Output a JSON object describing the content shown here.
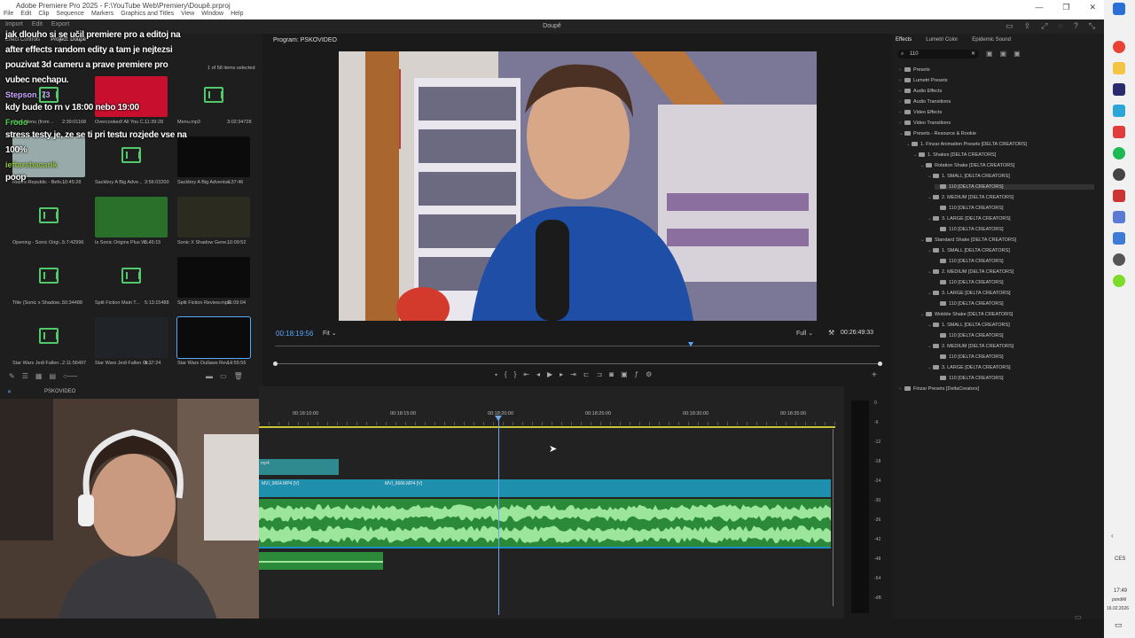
{
  "titlebar": {
    "app_title": "Adobe Premiere Pro 2025 - F:\\YouTube Web\\Premiery\\Doupě.prproj",
    "menu": [
      "File",
      "Edit",
      "Clip",
      "Sequence",
      "Markers",
      "Graphics and Titles",
      "View",
      "Window",
      "Help"
    ]
  },
  "appbar": {
    "document": "Doupě",
    "tabs": [
      "Import",
      "Edit",
      "Export"
    ]
  },
  "project": {
    "tabs": [
      "Effect Controls",
      "Project: Doupě"
    ],
    "count": "1 of 58 items selected",
    "items": [
      {
        "name": "Main Menu (from ..",
        "dur": "2:39:01168"
      },
      {
        "name": "Overcooked! All You C...",
        "dur": "11:39:28"
      },
      {
        "name": "Menu.mp3",
        "dur": "3:02:34728"
      },
      {
        "name": "Riders Republic - Befo...",
        "dur": "10:45:28"
      },
      {
        "name": "Sackboy A Big Adve...",
        "dur": "3:56:03200"
      },
      {
        "name": "Sackboy A Big Adventu...",
        "dur": "4:37:46"
      },
      {
        "name": "Opening - Sonic Origi...",
        "dur": "5:7:42996"
      },
      {
        "name": "Is Sonic Origins Plus W...",
        "dur": "5:45:15"
      },
      {
        "name": "Sonic X Shadow Gene...",
        "dur": "10:09:52"
      },
      {
        "name": "Title (Sonic x Shadow...",
        "dur": "50:34488"
      },
      {
        "name": "Split Fiction Main T...",
        "dur": "5:13:15488"
      },
      {
        "name": "Split Fiction Review.mp4",
        "dur": "11:09:04"
      },
      {
        "name": "Star Wars Jedi Fallen...",
        "dur": "2:11:56497"
      },
      {
        "name": "Star Wars Jedi Fallen Or...",
        "dur": "6:37:24"
      },
      {
        "name": "Star Wars Outlaws Rev...",
        "dur": "14:55:56"
      }
    ],
    "chat": [
      {
        "type": "line",
        "text": "jak dlouho si se učil premiere pro a editoj na"
      },
      {
        "type": "line",
        "text": "after effects random edity a tam je nejtezsi"
      },
      {
        "type": "line",
        "text": "pouzivat 3d cameru a prave premiere pro"
      },
      {
        "type": "line",
        "text": "vubec nechapu."
      },
      {
        "type": "user",
        "text": "Stepson_73",
        "color": "#c9a6ff"
      },
      {
        "type": "line",
        "text": "kdy bude to rn v 18:00 nebo 19:00"
      },
      {
        "type": "user",
        "text": "Frodo",
        "color": "#4dd24d"
      },
      {
        "type": "line",
        "text": "stress testy je, ze se ti pri testu rozjede vse na"
      },
      {
        "type": "line",
        "text": "100%"
      },
      {
        "type": "user",
        "text": "ieftarsbacarik",
        "color": "#8fbf3f"
      },
      {
        "type": "line",
        "text": "poop"
      }
    ]
  },
  "program": {
    "label": "Program: PSKOVIDEO",
    "timecode_left": "00:18:19:56",
    "fit": "Fit",
    "quality": "Full",
    "timecode_right": "00:26:49:33"
  },
  "effects": {
    "tabs": [
      "Effects",
      "Lumetri Color",
      "Epidemic Sound"
    ],
    "search": "110",
    "tree": [
      {
        "depth": 0,
        "label": "Presets",
        "open": false
      },
      {
        "depth": 0,
        "label": "Lumetri Presets",
        "open": false
      },
      {
        "depth": 0,
        "label": "Audio Effects",
        "open": false
      },
      {
        "depth": 0,
        "label": "Audio Transitions",
        "open": false
      },
      {
        "depth": 0,
        "label": "Video Effects",
        "open": false
      },
      {
        "depth": 0,
        "label": "Video Transitions",
        "open": false
      },
      {
        "depth": 0,
        "label": "Presets - Resource & Rookie",
        "open": true
      },
      {
        "depth": 1,
        "label": "1. Finzar Animation Presets [DELTA CREATORS]",
        "open": true
      },
      {
        "depth": 2,
        "label": "1. Shakes [DELTA CREATORS]",
        "open": true
      },
      {
        "depth": 3,
        "label": "Rotation Shake [DELTA CREATORS]",
        "open": true
      },
      {
        "depth": 4,
        "label": "1. SMALL [DELTA CREATORS]",
        "open": true
      },
      {
        "depth": 5,
        "label": "110 [DELTA CREATORS]",
        "leaf": true,
        "selected": true
      },
      {
        "depth": 4,
        "label": "2. MEDIUM [DELTA CREATORS]",
        "open": true
      },
      {
        "depth": 5,
        "label": "110 [DELTA CREATORS]",
        "leaf": true
      },
      {
        "depth": 4,
        "label": "3. LARGE [DELTA CREATORS]",
        "open": true
      },
      {
        "depth": 5,
        "label": "110 [DELTA CREATORS]",
        "leaf": true
      },
      {
        "depth": 3,
        "label": "Standard Shake [DELTA CREATORS]",
        "open": true
      },
      {
        "depth": 4,
        "label": "1. SMALL [DELTA CREATORS]",
        "open": true
      },
      {
        "depth": 5,
        "label": "110 [DELTA CREATORS]",
        "leaf": true
      },
      {
        "depth": 4,
        "label": "2. MEDIUM [DELTA CREATORS]",
        "open": true
      },
      {
        "depth": 5,
        "label": "110 [DELTA CREATORS]",
        "leaf": true
      },
      {
        "depth": 4,
        "label": "3. LARGE [DELTA CREATORS]",
        "open": true
      },
      {
        "depth": 5,
        "label": "110 [DELTA CREATORS]",
        "leaf": true
      },
      {
        "depth": 3,
        "label": "Wobble Shake [DELTA CREATORS]",
        "open": true
      },
      {
        "depth": 4,
        "label": "1. SMALL [DELTA CREATORS]",
        "open": true
      },
      {
        "depth": 5,
        "label": "110 [DELTA CREATORS]",
        "leaf": true
      },
      {
        "depth": 4,
        "label": "2. MEDIUM [DELTA CREATORS]",
        "open": true
      },
      {
        "depth": 5,
        "label": "110 [DELTA CREATORS]",
        "leaf": true
      },
      {
        "depth": 4,
        "label": "3. LARGE [DELTA CREATORS]",
        "open": true
      },
      {
        "depth": 5,
        "label": "110 [DELTA CREATORS]",
        "leaf": true
      },
      {
        "depth": 0,
        "label": "Finzar Presets [DeltaCreators]",
        "open": false
      }
    ]
  },
  "timeline": {
    "sequence": "PSKOVIDEO",
    "ruler": [
      "00:18:10:00",
      "00:18:15:00",
      "00:18:20:00",
      "00:18:25:00",
      "00:18:30:00",
      "00:18:35:00"
    ],
    "clips": {
      "upper": "mp4",
      "v1a": "MVI_9664.MP4 [V]",
      "v1b": "MVI_9666.MP4 [V]"
    }
  },
  "meter_scale": [
    "0",
    "-6",
    "-12",
    "-18",
    "-24",
    "-30",
    "-36",
    "-42",
    "-48",
    "-54",
    "-dB"
  ],
  "taskbar": {
    "lang": "CES",
    "time": "17:49",
    "day": "pondělí",
    "date": "16.02.2026"
  }
}
